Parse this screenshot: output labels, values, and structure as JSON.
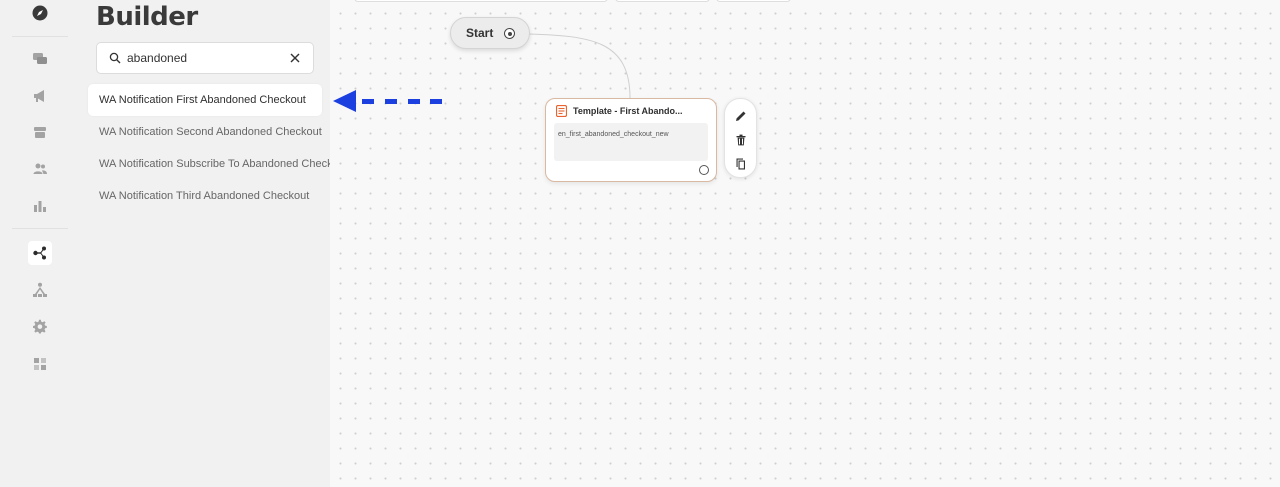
{
  "sidebar": {
    "icons": [
      "compass-icon",
      "chat-icon",
      "megaphone-icon",
      "box-icon",
      "users-icon",
      "bar-chart-icon",
      "flow-icon",
      "hierarchy-icon",
      "gear-icon",
      "grid-icon"
    ],
    "active_icon": "flow-icon"
  },
  "panel": {
    "title": "Builder",
    "search": {
      "value": "abandoned",
      "placeholder": "Search"
    },
    "items": [
      {
        "label": "WA Notification First Abandoned Checkout",
        "selected": true
      },
      {
        "label": "WA Notification Second Abandoned Checkout",
        "selected": false
      },
      {
        "label": "WA Notification Subscribe To Abandoned Checkout",
        "selected": false
      },
      {
        "label": "WA Notification Third Abandoned Checkout",
        "selected": false
      }
    ]
  },
  "canvas": {
    "start_node": {
      "label": "Start"
    },
    "template_node": {
      "title": "Template - First Abando...",
      "content": "en_first_abandoned_checkout_new",
      "border_color": "#d9b9a2",
      "icon_color": "#e8632f"
    },
    "tools": [
      "edit-icon",
      "trash-icon",
      "copy-icon"
    ]
  },
  "annotation": {
    "arrow_color": "#1c3fe0"
  }
}
